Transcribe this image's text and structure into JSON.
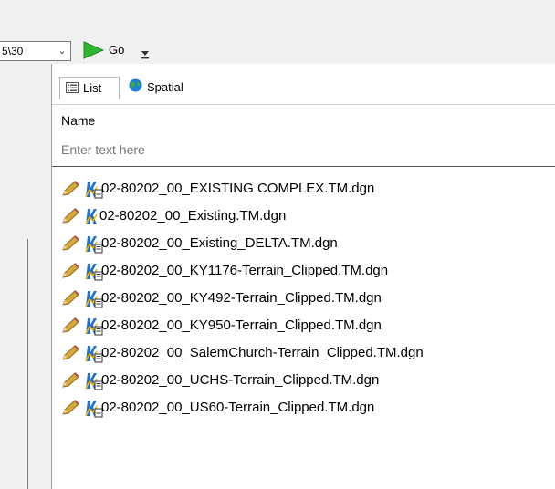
{
  "toolbar": {
    "path_value": "5\\30",
    "go_label": "Go",
    "overflow_icon": "chevron-down-icon"
  },
  "tabs": [
    {
      "label": "List",
      "icon": "list-icon",
      "active": true
    },
    {
      "label": "Spatial",
      "icon": "globe-icon",
      "active": false
    }
  ],
  "table": {
    "column_header": "Name",
    "filter_placeholder": "Enter text here"
  },
  "files": [
    {
      "name": "02-80202_00_EXISTING COMPLEX.TM.dgn",
      "icon": "terrain-model-icon"
    },
    {
      "name": "02-80202_00_Existing.TM.dgn",
      "icon": "terrain-model-icon"
    },
    {
      "name": "02-80202_00_Existing_DELTA.TM.dgn",
      "icon": "terrain-model-icon"
    },
    {
      "name": "02-80202_00_KY1176-Terrain_Clipped.TM.dgn",
      "icon": "terrain-model-icon"
    },
    {
      "name": "02-80202_00_KY492-Terrain_Clipped.TM.dgn",
      "icon": "terrain-model-icon"
    },
    {
      "name": "02-80202_00_KY950-Terrain_Clipped.TM.dgn",
      "icon": "terrain-model-icon"
    },
    {
      "name": "02-80202_00_SalemChurch-Terrain_Clipped.TM.dgn",
      "icon": "terrain-model-icon"
    },
    {
      "name": "02-80202_00_UCHS-Terrain_Clipped.TM.dgn",
      "icon": "terrain-model-icon"
    },
    {
      "name": "02-80202_00_US60-Terrain_Clipped.TM.dgn",
      "icon": "terrain-model-icon"
    }
  ],
  "colors": {
    "go_arrow": "#2fb52f",
    "pencil": "#c89a2e",
    "terrain_icon": "#1f6fd1",
    "globe": "#1e7fd6"
  }
}
